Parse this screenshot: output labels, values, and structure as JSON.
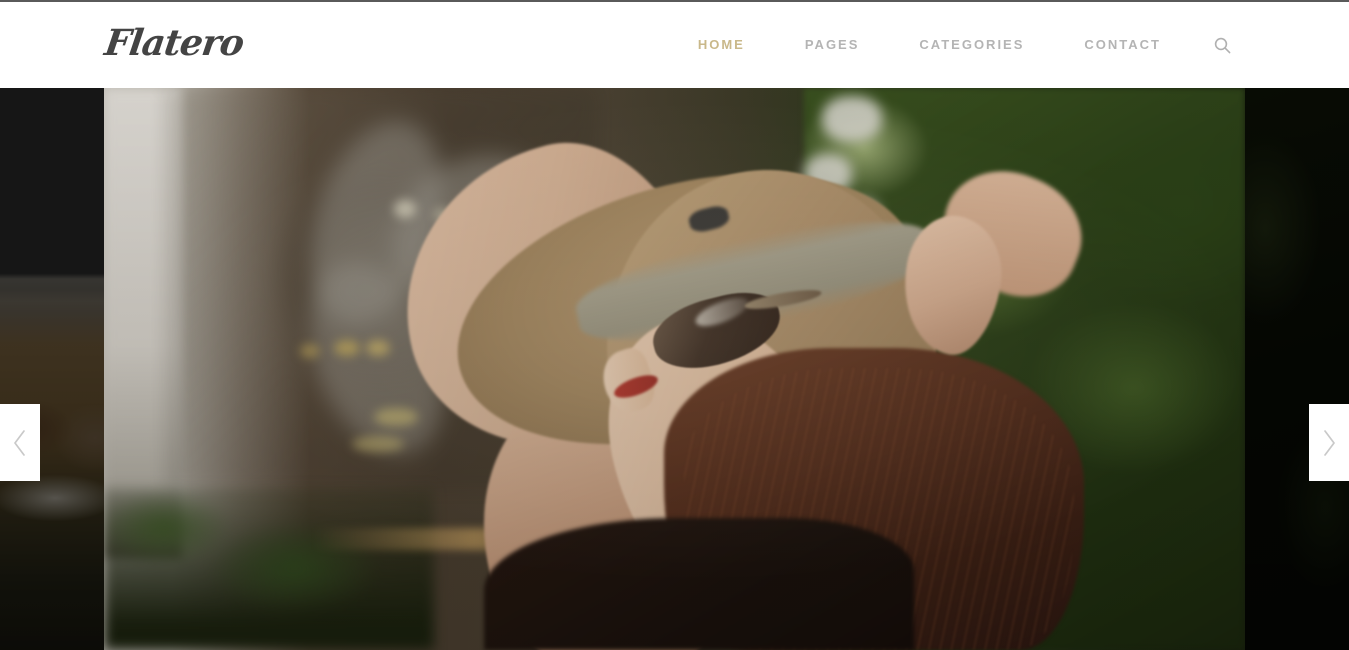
{
  "site": {
    "brand": "Flatero"
  },
  "header": {
    "nav": [
      {
        "label": "HOME",
        "active": true
      },
      {
        "label": "PAGES",
        "active": false
      },
      {
        "label": "CATEGORIES",
        "active": false
      },
      {
        "label": "CONTACT",
        "active": false
      }
    ],
    "search_icon": "search-icon",
    "active_color": "#c9b88a",
    "inactive_color": "#b4b4b4",
    "background": "#ffffff"
  },
  "slider": {
    "prev_icon": "chevron-left-icon",
    "next_icon": "chevron-right-icon",
    "current_slide_alt": "Woman in profile wearing a tan fedora hat and sunglasses, red lipstick, long auburn hair, black tank top, arm raised, standing in a greenhouse with blurred industrial fan and green foliage",
    "prev_slide_alt": "Darkened photo of cattle grazing in a dry grass field",
    "next_slide_alt": "Darkened photo of dense green foliage",
    "arrow_background": "#ffffff"
  }
}
